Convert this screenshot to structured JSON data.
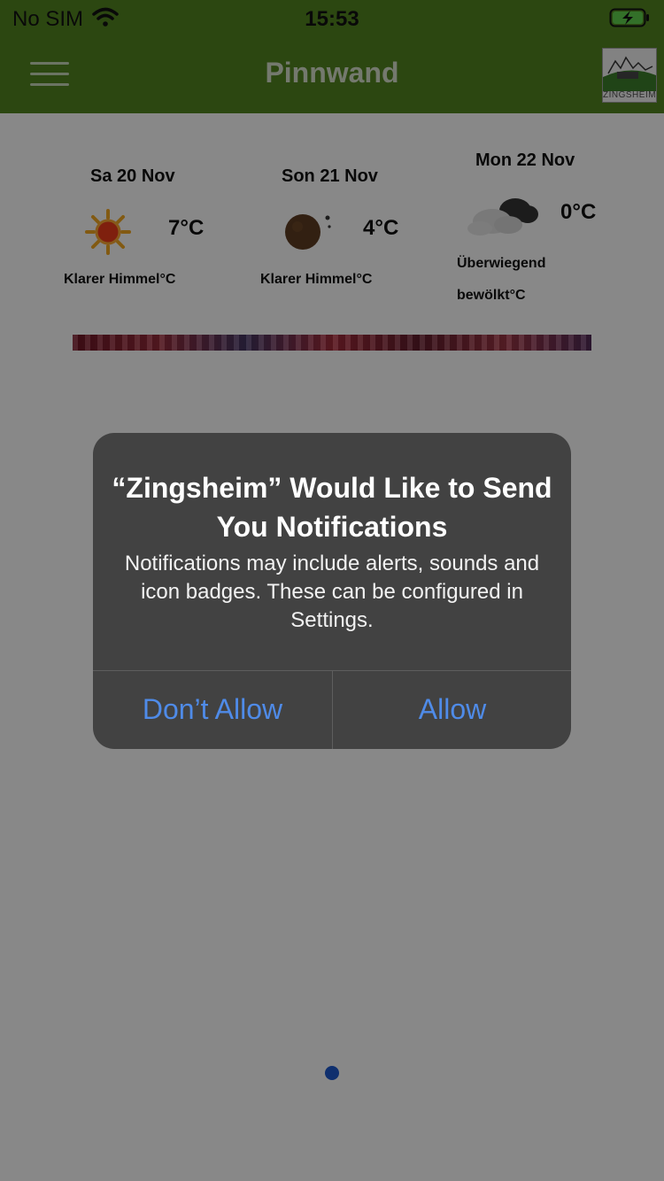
{
  "status": {
    "carrier": "No SIM",
    "time": "15:53"
  },
  "nav": {
    "title": "Pinnwand",
    "logo_text": "ZINGSHEIM"
  },
  "weather": [
    {
      "date": "Sa 20 Nov",
      "temp": "7°C",
      "desc": "Klarer Himmel°C",
      "icon": "sun-icon"
    },
    {
      "date": "Son 21 Nov",
      "temp": "4°C",
      "desc": "Klarer Himmel°C",
      "icon": "moon-icon"
    },
    {
      "date": "Mon 22 Nov",
      "temp": "0°C",
      "desc_line1": "Überwiegend",
      "desc_line2": "bewölkt°C",
      "icon": "cloud-icon"
    }
  ],
  "alert": {
    "title": "“Zingsheim” Would Like to Send You Notifications",
    "message": "Notifications may include alerts, sounds and icon badges. These can be configured in Settings.",
    "deny_label": "Don’t Allow",
    "allow_label": "Allow"
  },
  "colors": {
    "header_green": "#4f7f1f",
    "alert_bg": "#424242",
    "button_blue": "#4f8be8",
    "page_dot": "#1c55c4"
  }
}
